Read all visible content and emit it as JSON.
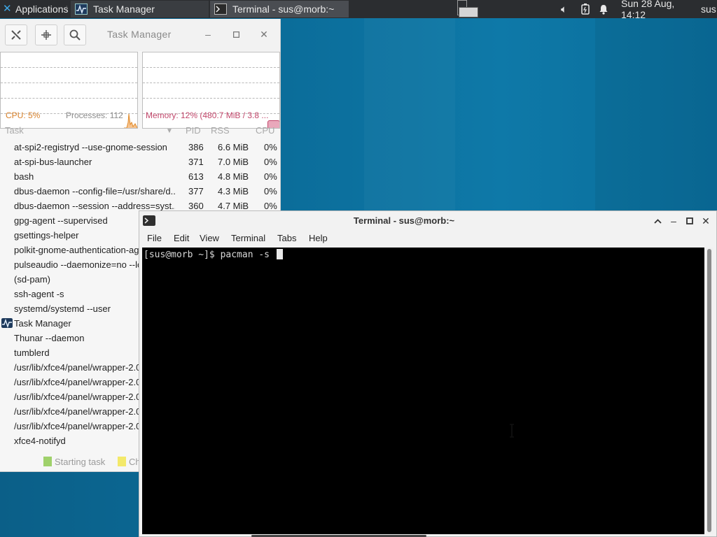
{
  "panel": {
    "applications": "Applications",
    "tasks": [
      {
        "label": "Task Manager"
      },
      {
        "label": "Terminal - sus@morb:~"
      }
    ],
    "clock": "Sun 28 Aug, 14:12",
    "user": "sus"
  },
  "task_manager": {
    "title": "Task Manager",
    "cpu_stat": "CPU: 5%",
    "processes_stat": "Processes: 112",
    "memory_stat": "Memory: 12% (480.7 MiB / 3.8 ...",
    "columns": {
      "task": "Task",
      "pid": "PID",
      "rss": "RSS",
      "cpu": "CPU"
    },
    "rows": [
      {
        "task": "at-spi2-registryd --use-gnome-session",
        "pid": "386",
        "rss": "6.6 MiB",
        "cpu": "0%"
      },
      {
        "task": "at-spi-bus-launcher",
        "pid": "371",
        "rss": "7.0 MiB",
        "cpu": "0%"
      },
      {
        "task": "bash",
        "pid": "613",
        "rss": "4.8 MiB",
        "cpu": "0%"
      },
      {
        "task": "dbus-daemon --config-file=/usr/share/d...",
        "pid": "377",
        "rss": "4.3 MiB",
        "cpu": "0%"
      },
      {
        "task": "dbus-daemon --session --address=syst...",
        "pid": "360",
        "rss": "4.7 MiB",
        "cpu": "0%"
      },
      {
        "task": "gpg-agent --supervised",
        "pid": "",
        "rss": "",
        "cpu": ""
      },
      {
        "task": "gsettings-helper",
        "pid": "",
        "rss": "",
        "cpu": ""
      },
      {
        "task": "polkit-gnome-authentication-ag",
        "pid": "",
        "rss": "",
        "cpu": ""
      },
      {
        "task": "pulseaudio --daemonize=no --lo",
        "pid": "",
        "rss": "",
        "cpu": ""
      },
      {
        "task": "(sd-pam)",
        "pid": "",
        "rss": "",
        "cpu": ""
      },
      {
        "task": "ssh-agent -s",
        "pid": "",
        "rss": "",
        "cpu": ""
      },
      {
        "task": "systemd/systemd --user",
        "pid": "",
        "rss": "",
        "cpu": ""
      },
      {
        "task": "Task Manager",
        "pid": "",
        "rss": "",
        "cpu": "",
        "icon": "task-manager-icon"
      },
      {
        "task": "Thunar --daemon",
        "pid": "",
        "rss": "",
        "cpu": ""
      },
      {
        "task": "tumblerd",
        "pid": "",
        "rss": "",
        "cpu": ""
      },
      {
        "task": "/usr/lib/xfce4/panel/wrapper-2.0",
        "pid": "",
        "rss": "",
        "cpu": ""
      },
      {
        "task": "/usr/lib/xfce4/panel/wrapper-2.0",
        "pid": "",
        "rss": "",
        "cpu": ""
      },
      {
        "task": "/usr/lib/xfce4/panel/wrapper-2.0",
        "pid": "",
        "rss": "",
        "cpu": ""
      },
      {
        "task": "/usr/lib/xfce4/panel/wrapper-2.0",
        "pid": "",
        "rss": "",
        "cpu": ""
      },
      {
        "task": "/usr/lib/xfce4/panel/wrapper-2.0",
        "pid": "",
        "rss": "",
        "cpu": ""
      },
      {
        "task": "xfce4-notifyd",
        "pid": "",
        "rss": "",
        "cpu": ""
      }
    ],
    "legend": {
      "starting": "Starting task",
      "changing": "Ch",
      "starting_color": "#9fd16b",
      "changing_color": "#f3e96a"
    }
  },
  "terminal": {
    "title": "Terminal - sus@morb:~",
    "menu": {
      "file": "File",
      "edit": "Edit",
      "view": "View",
      "terminal": "Terminal",
      "tabs": "Tabs",
      "help": "Help"
    },
    "prompt": "[sus@morb ~]$ pacman -s "
  }
}
